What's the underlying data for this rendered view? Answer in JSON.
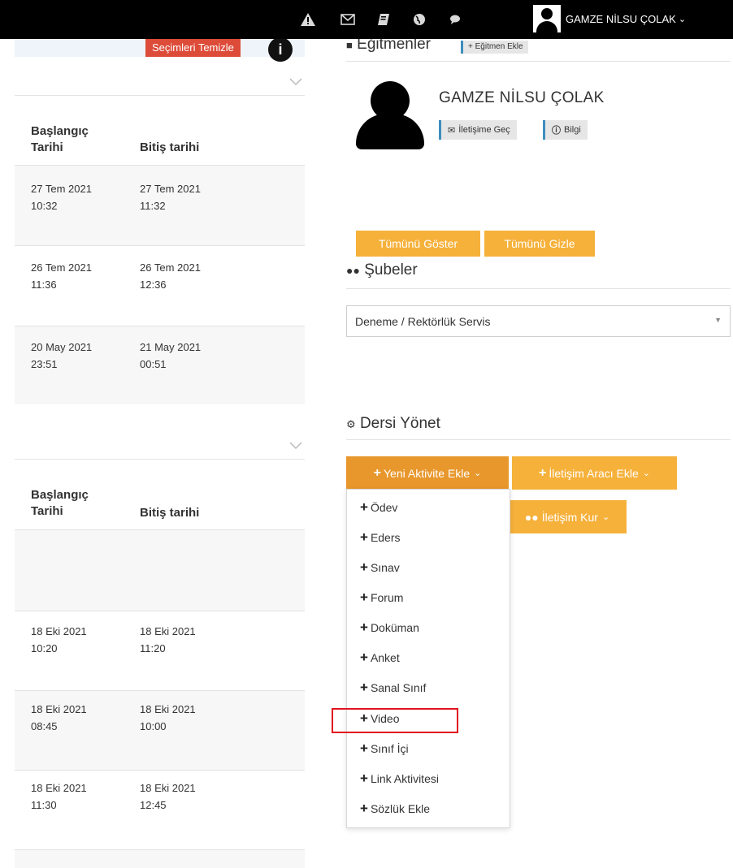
{
  "topbar": {
    "icons": [
      "warning-icon",
      "mail-icon",
      "book-icon",
      "globe-icon",
      "chat-icon"
    ],
    "user_name": "GAMZE NİLSU ÇOLAK",
    "user_chevron": "⌄"
  },
  "left_panel": {
    "clear_button": "Seçimleri Temizle",
    "info_glyph": "i",
    "table1": {
      "headers": {
        "start_line1": "Başlangıç",
        "start_line2": "Tarihi",
        "end": "Bitiş tarihi"
      },
      "rows": [
        {
          "start_date": "27 Tem 2021",
          "start_time": "10:32",
          "end_date": "27 Tem 2021",
          "end_time": "11:32"
        },
        {
          "start_date": "26 Tem 2021",
          "start_time": "11:36",
          "end_date": "26 Tem 2021",
          "end_time": "12:36"
        },
        {
          "start_date": "20 May 2021",
          "start_time": "23:51",
          "end_date": "21 May 2021",
          "end_time": "00:51"
        }
      ]
    },
    "table2": {
      "headers": {
        "start_line1": "Başlangıç",
        "start_line2": "Tarihi",
        "end": "Bitiş tarihi"
      },
      "rows": [
        {
          "start_date": "18 Eki 2021",
          "start_time": "10:20",
          "end_date": "18 Eki 2021",
          "end_time": "11:20"
        },
        {
          "start_date": "18 Eki 2021",
          "start_time": "08:45",
          "end_date": "18 Eki 2021",
          "end_time": "10:00"
        },
        {
          "start_date": "18 Eki 2021",
          "start_time": "11:30",
          "end_date": "18 Eki 2021",
          "end_time": "12:45"
        }
      ]
    }
  },
  "trainers": {
    "title": "Eğitmenler",
    "add_button": "+ Eğitmen Ekle",
    "name": "GAMZE NİLSU ÇOLAK",
    "contact_button": "İletişime Geç",
    "info_button": "Bilgi",
    "show_all": "Tümünü Göster",
    "hide_all": "Tümünü Gizle"
  },
  "branches": {
    "title": "Şubeler",
    "selected": "Deneme / Rektörlük Servis"
  },
  "manage": {
    "title": "Dersi Yönet",
    "new_activity_button": "Yeni Aktivite Ekle",
    "comm_tool_button": "İletişim Aracı Ekle",
    "contact_button": "İletişim Kur",
    "menu": [
      "Ödev",
      "Eders",
      "Sınav",
      "Forum",
      "Doküman",
      "Anket",
      "Sanal Sınıf",
      "Video",
      "Sınıf İçi",
      "Link Aktivitesi",
      "Sözlük Ekle"
    ],
    "highlighted_item": "Video",
    "highlight_color": "#e0141e"
  },
  "colors": {
    "topbar": "#000000",
    "orange_button": "#f6b13b",
    "orange_active": "#e8972c",
    "clear_button": "#dd4b39",
    "accent_blue": "#3c8dbc",
    "row_bg": "#f7f7f7"
  }
}
